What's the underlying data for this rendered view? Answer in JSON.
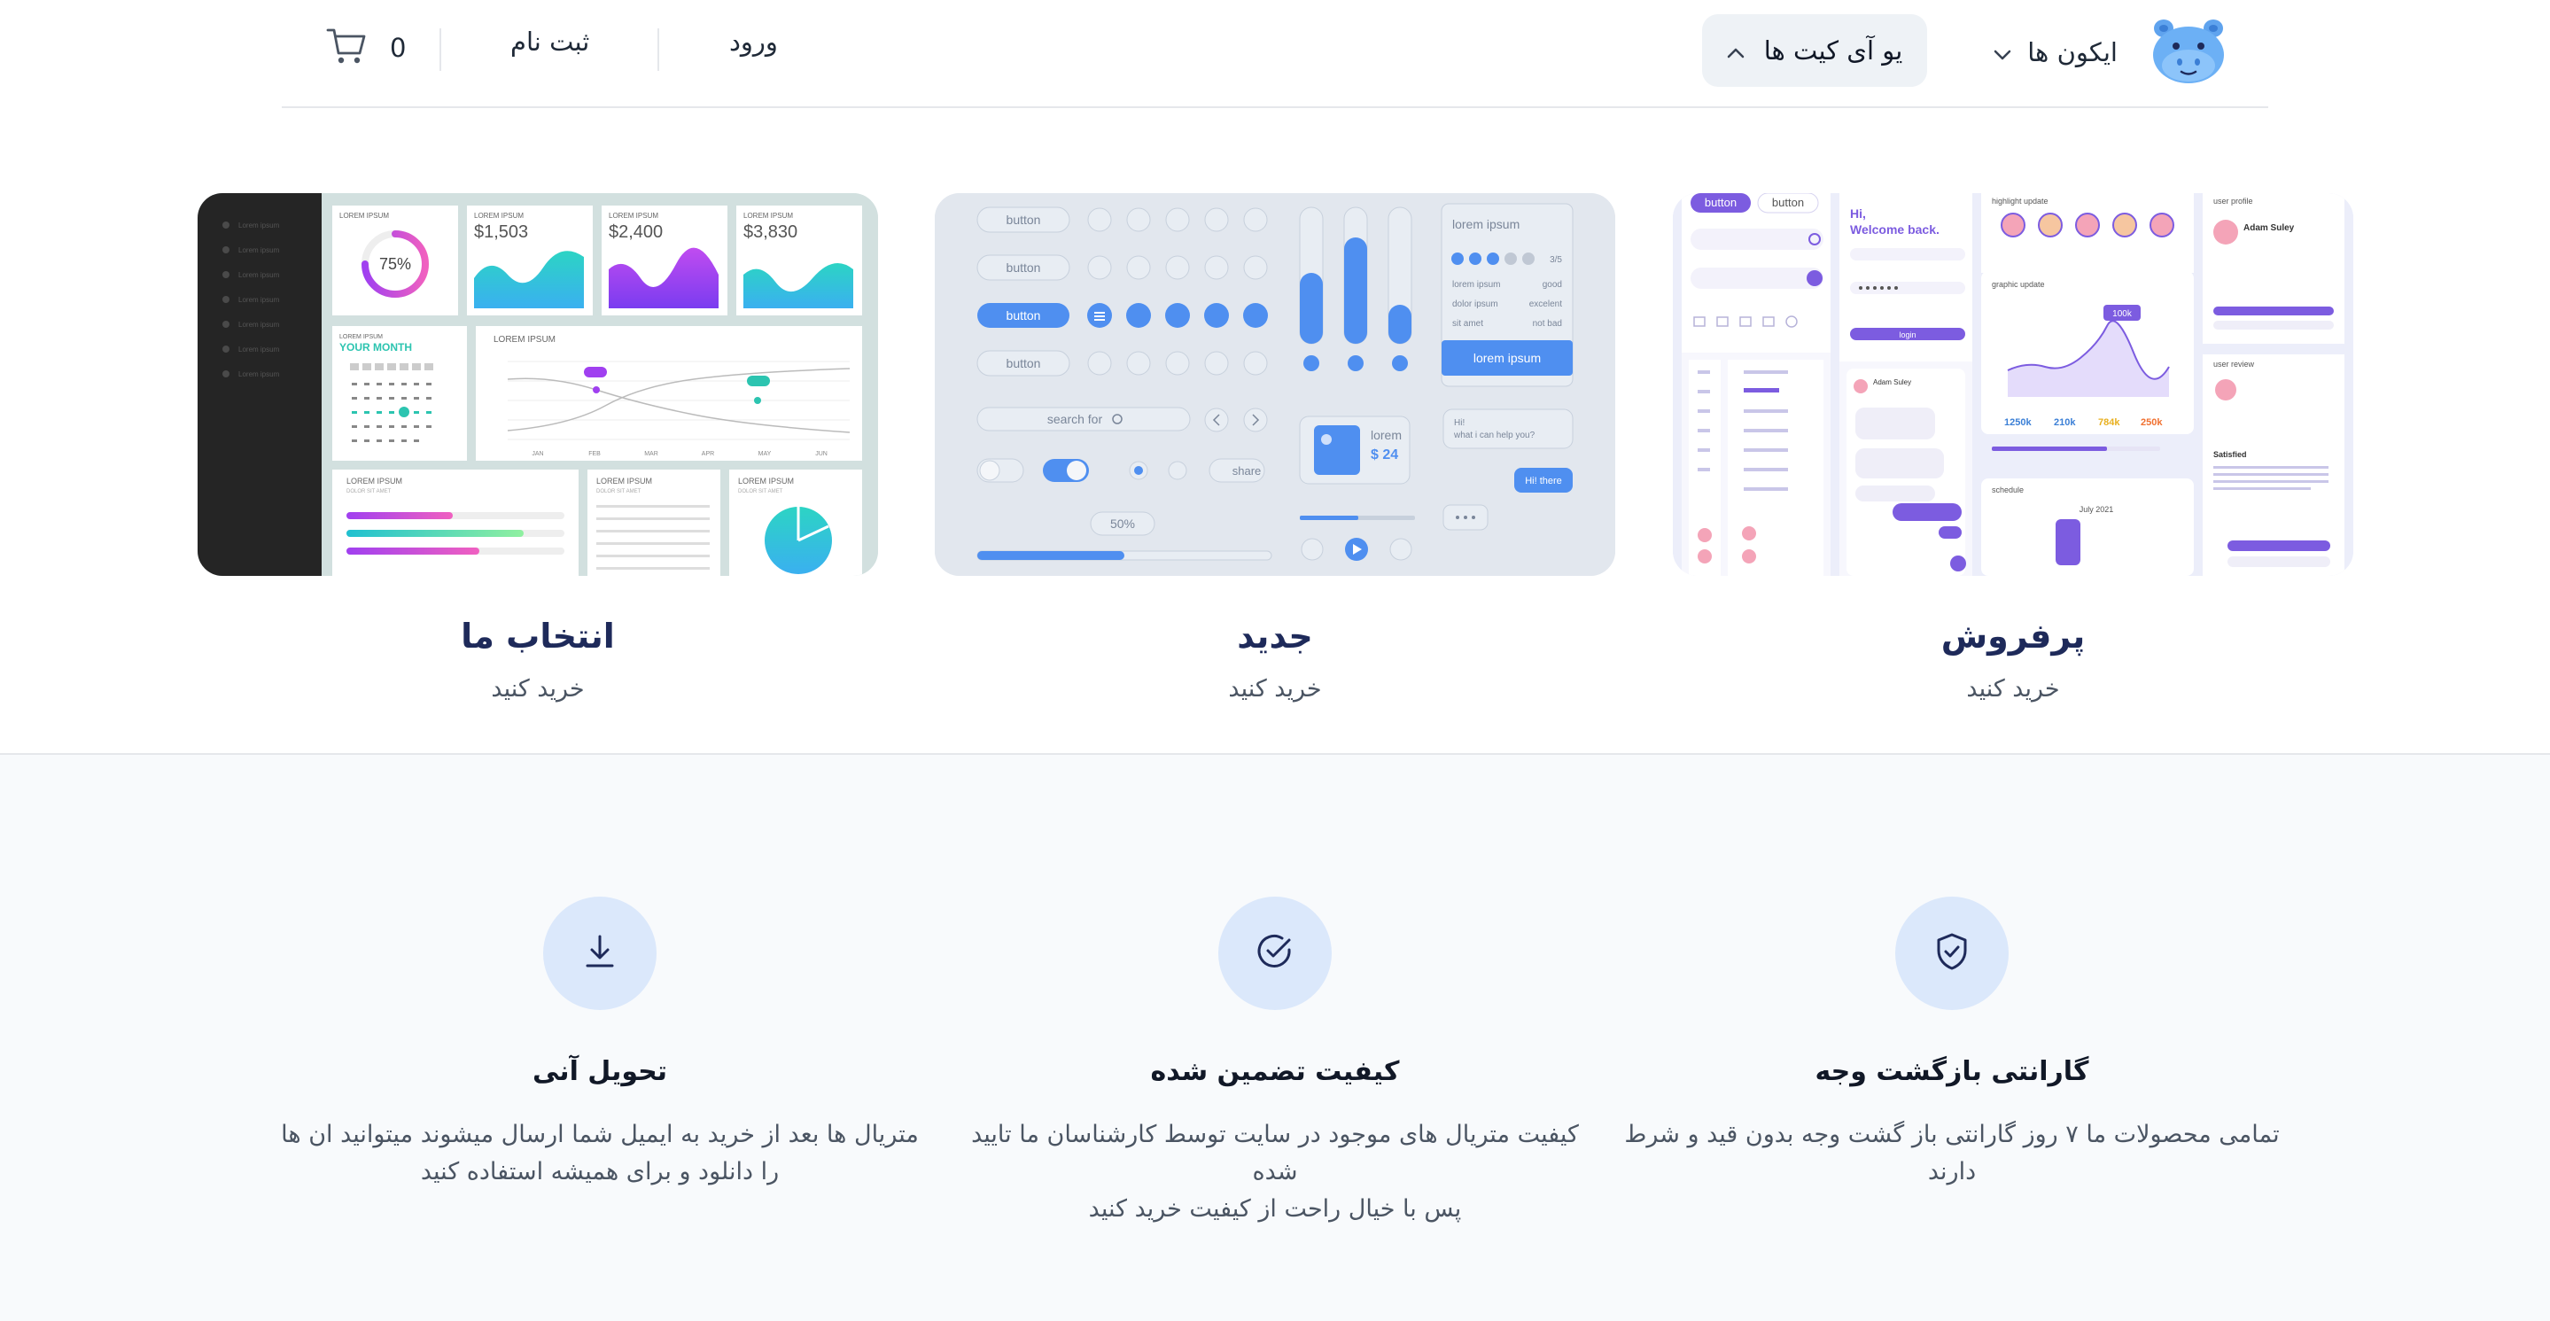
{
  "header": {
    "nav_icons_label": "ایکون ها",
    "nav_uikit_label": "یو آی کیت ها",
    "login_label": "ورود",
    "signup_label": "ثبت نام",
    "cart_count": "0"
  },
  "cards": [
    {
      "title": "پرفروش",
      "subtitle": "خرید کنید",
      "preview": {
        "button_tab_a": "button",
        "button_tab_b": "button",
        "welcome": "Hi,",
        "welcome2": "Welcome back.",
        "highlight": "highlight update",
        "graphic": "graphic update",
        "badge": "100k",
        "stat1": "1250k",
        "stat2": "210k",
        "stat3": "784k",
        "stat4": "250k",
        "schedule": "schedule",
        "month": "July 2021",
        "user_profile": "user profile",
        "name": "Adam Suley",
        "user_review": "user review",
        "satisfied": "Satisfied",
        "login": "login"
      }
    },
    {
      "title": "جدید",
      "subtitle": "خرید کنید",
      "preview": {
        "button": "button",
        "search": "search for",
        "share": "share",
        "percent": "50%",
        "lorem": "lorem ipsum",
        "price_label": "lorem",
        "price": "$ 24",
        "rating": "3/5",
        "row1a": "lorem ipsum",
        "row1b": "good",
        "row2a": "dolor ipsum",
        "row2b": "excelent",
        "row3a": "sit amet",
        "row3b": "not bad",
        "chat1": "Hi!",
        "chat2": "what i can help you?",
        "chat3": "Hi! there"
      }
    },
    {
      "title": "انتخاب ما",
      "subtitle": "خرید کنید",
      "preview": {
        "sidebar_item": "Lorem ipsum",
        "lorem": "LOREM IPSUM",
        "donut": "75%",
        "price1": "$1,503",
        "price2": "$2,400",
        "price3": "$3,830",
        "month_label": "YOUR MONTH",
        "dolor": "DOLOR SIT AMET",
        "months": [
          "JAN",
          "FEB",
          "MAR",
          "APR",
          "MAY",
          "JUN"
        ]
      }
    }
  ],
  "features": [
    {
      "icon": "download-icon",
      "title": "تحویل آنی",
      "desc_line1": "متریال ها بعد از خرید به ایمیل شما ارسال میشوند میتوانید ان ها",
      "desc_line2": "را دانلود و برای همیشه استفاده کنید"
    },
    {
      "icon": "check-circle-icon",
      "title": "کیفیت تضمین شده",
      "desc_line1": "کیفیت متریال های موجود در سایت توسط کارشناسان ما تایید شده",
      "desc_line2": "پس با خیال راحت از کیفیت خرید کنید"
    },
    {
      "icon": "shield-check-icon",
      "title": "گارانتی بازگشت وجه",
      "desc_line1": "تمامی محصولات ما ۷ روز گارانتی باز گشت وجه بدون قید و شرط",
      "desc_line2": "دارند"
    }
  ],
  "colors": {
    "accent": "#4f8ff0",
    "purple": "#7c3aed",
    "title_navy": "#1e2a5a",
    "feature_circle": "#dbe8fb"
  }
}
